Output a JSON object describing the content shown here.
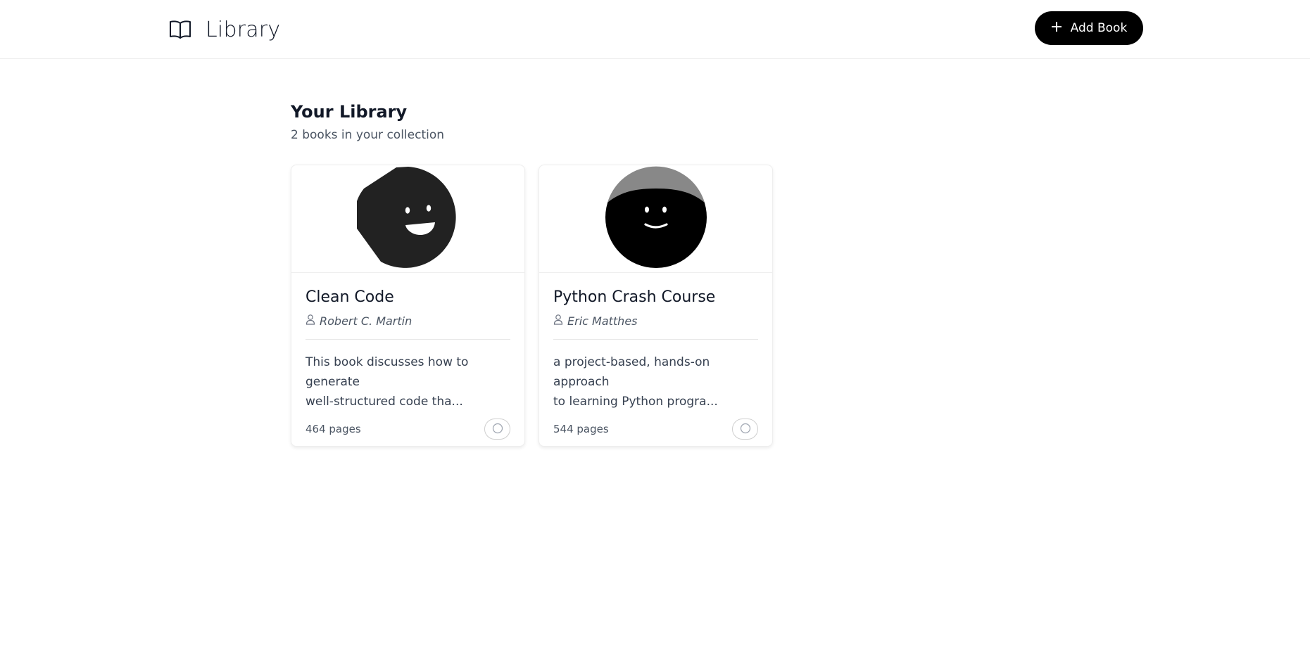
{
  "header": {
    "brand_icon": "open-book-icon",
    "title": "Library",
    "add_button": {
      "icon": "plus-icon",
      "label": "Add Book"
    }
  },
  "section": {
    "title": "Your Library",
    "subtitle": "2 books in your collection"
  },
  "books": [
    {
      "cover_icon": "smiling-face-avatar",
      "title": "Clean Code",
      "author_icon": "user-icon",
      "author": "Robert C. Martin",
      "description_line1": "This book discusses how to generate",
      "description_line2": "well-structured code tha...",
      "pages": "464 pages",
      "status_icon": "circle-icon"
    },
    {
      "cover_icon": "smiling-face-avatar",
      "title": "Python Crash Course",
      "author_icon": "user-icon",
      "author": "Eric Matthes",
      "description_line1": "a project-based, hands-on approach",
      "description_line2": "to learning Python progra...",
      "pages": "544 pages",
      "status_icon": "circle-icon"
    }
  ],
  "colors": {
    "primary": "#000000",
    "text": "#111827",
    "muted": "#4b5563",
    "border": "#eeeeee"
  }
}
